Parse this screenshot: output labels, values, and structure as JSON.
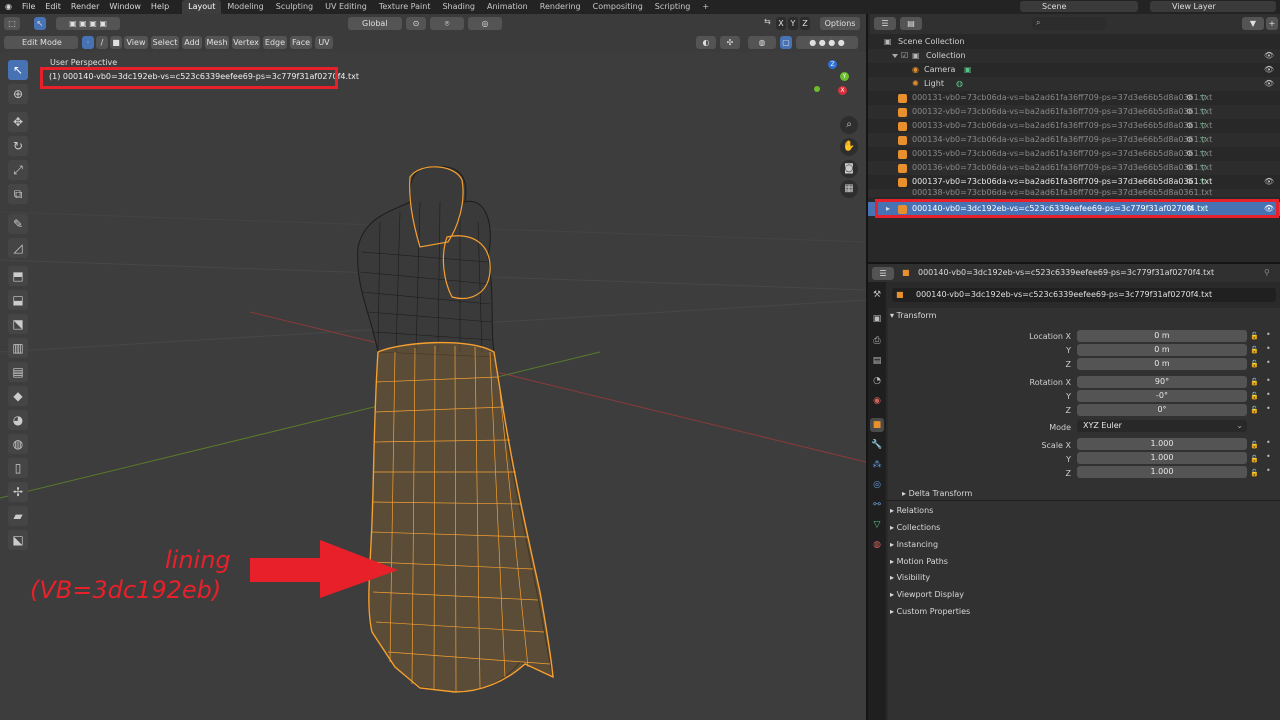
{
  "topbar": {
    "menus": [
      "File",
      "Edit",
      "Render",
      "Window",
      "Help"
    ],
    "workspaces": [
      "Layout",
      "Modeling",
      "Sculpting",
      "UV Editing",
      "Texture Paint",
      "Shading",
      "Animation",
      "Rendering",
      "Compositing",
      "Scripting",
      "+"
    ],
    "active_workspace": "Layout",
    "scene": "Scene",
    "view_layer": "View Layer"
  },
  "header2": {
    "orientation": "Global",
    "axes": [
      "X",
      "Y",
      "Z"
    ],
    "options": "Options"
  },
  "header3": {
    "mode": "Edit Mode",
    "menus": [
      "View",
      "Select",
      "Add",
      "Mesh",
      "Vertex",
      "Edge",
      "Face",
      "UV"
    ]
  },
  "viewport": {
    "perspective": "User Perspective",
    "object_name": "(1) 000140-vb0=3dc192eb-vs=c523c6339eefee69-ps=3c779f31af0270f4.txt",
    "annotation_line1": "lining",
    "annotation_line2": "(VB=3dc192eb)",
    "gizmo_x": "X",
    "gizmo_y": "Y",
    "gizmo_z": "Z"
  },
  "outliner": {
    "search_placeholder": "",
    "scene_collection": "Scene Collection",
    "collection": "Collection",
    "camera": "Camera",
    "light": "Light",
    "items": [
      "000131-vb0=73cb06da-vs=ba2ad61fa36ff709-ps=37d3e66b5d8a0361.txt",
      "000132-vb0=73cb06da-vs=ba2ad61fa36ff709-ps=37d3e66b5d8a0361.txt",
      "000133-vb0=73cb06da-vs=ba2ad61fa36ff709-ps=37d3e66b5d8a0361.txt",
      "000134-vb0=73cb06da-vs=ba2ad61fa36ff709-ps=37d3e66b5d8a0361.txt",
      "000135-vb0=73cb06da-vs=ba2ad61fa36ff709-ps=37d3e66b5d8a0361.txt",
      "000136-vb0=73cb06da-vs=ba2ad61fa36ff709-ps=37d3e66b5d8a0361.txt",
      "000137-vb0=73cb06da-vs=ba2ad61fa36ff709-ps=37d3e66b5d8a0361.txt",
      "000138-vb0=73cb06da-vs=ba2ad61fa36ff709-ps=37d3e66b5d8a0361.txt"
    ],
    "selected": "000140-vb0=3dc192eb-vs=c523c6339eefee69-ps=3c779f31af0270f4.txt"
  },
  "properties": {
    "object_title": "000140-vb0=3dc192eb-vs=c523c6339eefee69-ps=3c779f31af0270f4.txt",
    "object_field": "000140-vb0=3dc192eb-vs=c523c6339eefee69-ps=3c779f31af0270f4.txt",
    "transform": "Transform",
    "location_label": "Location X",
    "rotation_label": "Rotation X",
    "scale_label": "Scale X",
    "y": "Y",
    "z": "Z",
    "location": [
      "0 m",
      "0 m",
      "0 m"
    ],
    "rotation": [
      "90°",
      "-0°",
      "0°"
    ],
    "mode_label": "Mode",
    "mode_value": "XYZ Euler",
    "scale": [
      "1.000",
      "1.000",
      "1.000"
    ],
    "delta_transform": "Delta Transform",
    "panels": [
      "Relations",
      "Collections",
      "Instancing",
      "Motion Paths",
      "Visibility",
      "Viewport Display",
      "Custom Properties"
    ]
  },
  "colors": {
    "selection_orange": "#f5a030",
    "accent_blue": "#4772b3",
    "annotation_red": "#e8202a"
  }
}
